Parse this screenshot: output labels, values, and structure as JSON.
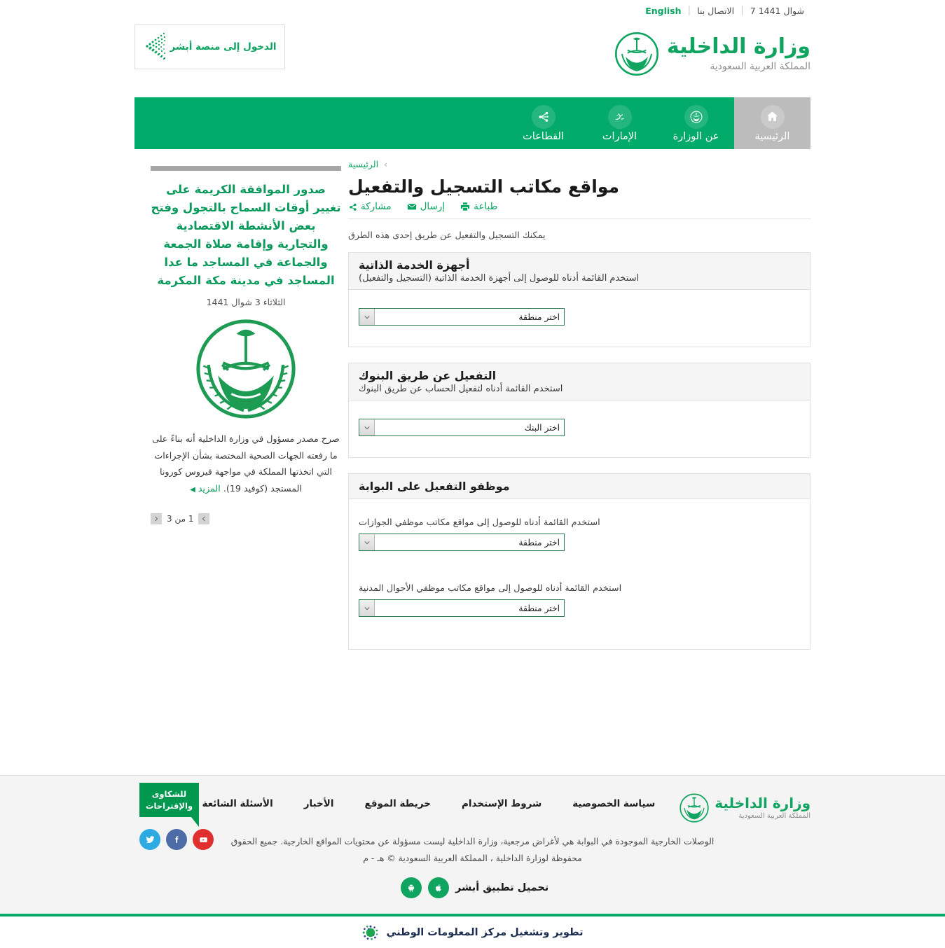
{
  "topbar": {
    "hijri_date": "7 شوال 1441",
    "contact": "الاتصال بنا",
    "english": "English",
    "separator": "|"
  },
  "brand": {
    "name_line1": "وزارة الداخلية",
    "name_line2": "المملكة العربية السعودية",
    "emblem_icon": "saudi-emblem-icon"
  },
  "absher": {
    "label": "الدخول إلى منصة أبشر",
    "chevron_icon": "dotted-chevron-icon"
  },
  "nav": {
    "items": [
      {
        "label": "الرئيسية",
        "icon": "home-icon",
        "active": true
      },
      {
        "label": "عن الوزارة",
        "icon": "ministry-emblem-icon",
        "active": false
      },
      {
        "label": "الإمارات",
        "icon": "imarat-calligraphy-icon",
        "active": false
      },
      {
        "label": "القطاعات",
        "icon": "sectors-network-icon",
        "active": false
      }
    ]
  },
  "breadcrumb": {
    "chevron": "‹",
    "home": "الرئيسية"
  },
  "page": {
    "title": "مواقع مكاتب التسجيل والتفعيل",
    "intro": "يمكنك التسجيل والتفعيل عن طريق إحدى هذه الطرق"
  },
  "toolbar": {
    "items": [
      {
        "label": "طباعة",
        "icon": "printer-icon"
      },
      {
        "label": "إرسال",
        "icon": "envelope-icon"
      },
      {
        "label": "مشاركة",
        "icon": "share-icon"
      }
    ]
  },
  "cards": [
    {
      "title": "أجهزة الخدمة الذاتية",
      "subtitle": "استخدم القائمة أدناه للوصول إلى أجهزة الخدمة الذاتية (التسجيل والتفعيل)",
      "fields": [
        {
          "label": "",
          "select_value": "اختر منطقة",
          "name": "region-select-self-service"
        }
      ]
    },
    {
      "title": "التفعيل عن طريق البنوك",
      "subtitle": "استخدم القائمة أدناه لتفعيل الحساب عن طريق البنوك",
      "fields": [
        {
          "label": "",
          "select_value": "اختر البنك",
          "name": "bank-select"
        }
      ]
    },
    {
      "title": "موظفو التفعيل على البوابة",
      "subtitle": "",
      "fields": [
        {
          "label": "استخدم القائمة أدناه للوصول إلى مواقع مكاتب موظفي الجوازات",
          "select_value": "اختر منطقة",
          "name": "region-select-passports"
        },
        {
          "label": "استخدم القائمة أدناه للوصول إلى مواقع مكاتب موظفي الأحوال المدنية",
          "select_value": "اختر منطقة",
          "name": "region-select-civil-affairs"
        }
      ]
    }
  ],
  "news": {
    "title": "صدور الموافقة الكريمة على تغيير أوقات السماح بالتجول وفتح بعض الأنشطة الاقتصادية والتجارية وإقامة صلاة الجمعة والجماعة في المساجد ما عدا المساجد في مدينة مكة المكرمة",
    "date": "الثلاثاء 3 شوال 1441",
    "emblem_icon": "saudi-emblem-icon",
    "body": "صرح مصدر مسؤول في وزارة الداخلية أنه بناءً على ما رفعته الجهات الصحية المختصة بشأن الإجراءات التي اتخذتها المملكة في مواجهة فيروس كورونا المستجد (كوفيد 19).",
    "more_label": "المزيد",
    "more_arrow": "◀",
    "pager_text": "1 من 3",
    "prev_icon": "chevron-left-icon",
    "next_icon": "chevron-right-icon"
  },
  "footer": {
    "links": [
      "سياسة الخصوصية",
      "شروط الإستخدام",
      "خريطة الموقع",
      "الأخبار",
      "الأسئلة الشائعة"
    ],
    "complaint_line1": "للشكاوى",
    "complaint_line2": "والإقتراحات",
    "socials": [
      {
        "name": "twitter-icon",
        "color": "#2caae1"
      },
      {
        "name": "facebook-icon",
        "color": "#4d6ba6"
      },
      {
        "name": "youtube-icon",
        "color": "#e02f2f"
      }
    ],
    "copyright_line1": "الوصلات الخارجية الموجودة في البوابة هي لأغراض مرجعية، وزارة الداخلية ليست مسؤولة عن محتويات المواقع الخارجية. جميع الحقوق",
    "copyright_line2": "محفوظة لوزارة الداخلية ، المملكة العربية السعودية © هـ - م",
    "app_label": "تحميل تطبيق أبشر",
    "app_icons": [
      "apple-icon",
      "android-icon"
    ]
  },
  "bottombar": {
    "text": "تطوير وتشغيل مركز المعلومات الوطني",
    "logo_icon": "nic-dots-icon"
  },
  "colors": {
    "brand_green": "#02ab69",
    "logo_green": "#0fa45f",
    "nav_active_gray": "#bcbcbc",
    "footer_bg": "#f4f4f4",
    "card_head_bg": "#f5f5f5",
    "select_border": "#2e7d52"
  }
}
